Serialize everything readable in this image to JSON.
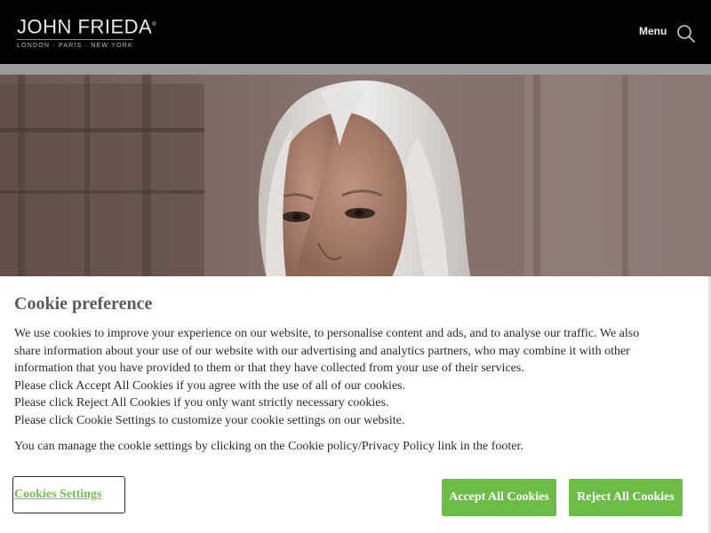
{
  "header": {
    "brand_name": "JOHN FRIEDA",
    "brand_mark": "®",
    "tagline": "LONDON · PARIS · NEW YORK",
    "menu_label": "Menu",
    "search_icon": "search-icon"
  },
  "hero": {
    "image": "woman-with-platinum-blonde-hair-photo"
  },
  "cookie_banner": {
    "title": "Cookie preference",
    "intro": "We use cookies to improve your experience on our website, to personalise content and ads, and to analyse our traffic. We also share information about your use of our website with our advertising and analytics partners, who may combine it with other information that you have provided to them or that they have collected from your use of their services.",
    "line_accept": "Please click Accept All Cookies if you agree with the use of all of our cookies.",
    "line_reject": "Please click Reject All Cookies if you only want strictly necessary cookies.",
    "line_settings": "Please click Cookie Settings to customize your cookie settings on our website.",
    "manage": "You can manage the cookie settings by clicking on the Cookie policy/Privacy Policy link in the footer.",
    "settings_label": "Cookies Settings",
    "accept_label": "Accept All Cookies",
    "reject_label": "Reject All Cookies"
  },
  "colors": {
    "header_bg": "#020202",
    "button_green": "#6cbd45",
    "link_green": "#71c24c",
    "title_gray": "#5a5a5a"
  }
}
